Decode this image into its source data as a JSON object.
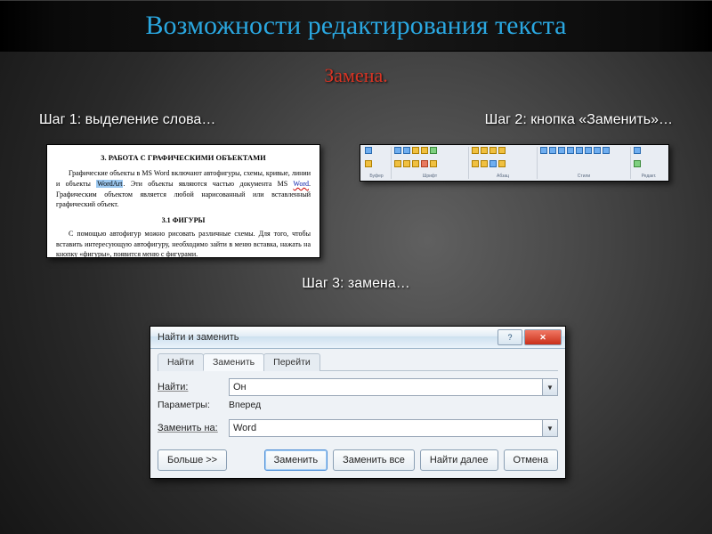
{
  "title": "Возможности редактирования текста",
  "subtitle": "Замена.",
  "steps": {
    "s1": "Шаг 1: выделение слова…",
    "s2": "Шаг 2: кнопка «Заменить»…",
    "s3": "Шаг 3: замена…"
  },
  "doc": {
    "h1": "3. РАБОТА С ГРАФИЧЕСКИМИ ОБЪЕКТАМИ",
    "p1a": "Графические объекты в MS Word включают автофигуры, схемы, кривые, линии и объекты ",
    "hl": "WordArt",
    "p1b": ". Эти объекты являются частью документа MS ",
    "wordund": "Word",
    "p1c": ". Графическим объектом является любой нарисованный или вставленный графический объект.",
    "h2": "3.1 ФИГУРЫ",
    "p2": "С помощью автофигур можно рисовать различные схемы. Для того, чтобы вставить интересующую автофигуру, необходимо зайти в меню вставка, нажать на кнопку «фигуры», появится меню с фигурами."
  },
  "dialog": {
    "title": "Найти и заменить",
    "tabs": {
      "find": "Найти",
      "replace": "Заменить",
      "goto": "Перейти"
    },
    "find_label": "Найти:",
    "find_value": "Он",
    "params_label": "Параметры:",
    "params_value": "Вперед",
    "replace_label": "Заменить на:",
    "replace_value": "Word",
    "buttons": {
      "more": "Больше >>",
      "replace": "Заменить",
      "replace_all": "Заменить все",
      "find_next": "Найти далее",
      "cancel": "Отмена"
    }
  }
}
